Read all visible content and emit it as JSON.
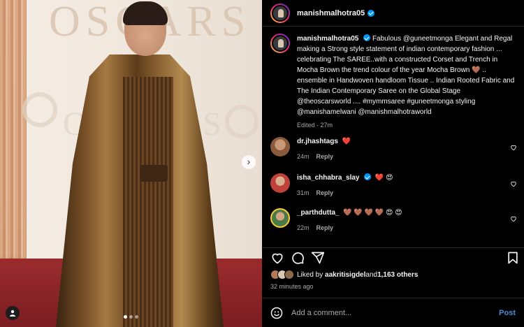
{
  "photo": {
    "backdrop_text": "OSCARS",
    "backdrop_text_small": "OSCARS",
    "carousel": {
      "total_dots": 3,
      "active_index": 0
    }
  },
  "header": {
    "username": "manishmalhotra05"
  },
  "caption": {
    "username": "manishmalhotra05",
    "text": "Fabulous @guneetmonga Elegant and Regal making a Strong style statement of indian contemporary fashion ... celebrating The SAREE..with a constructed Corset and Trench in Mocha Brown the trend colour of the year Mocha Brown 🤎 .. ensemble in Handwoven handloom Tissue .. Indian Rooted Fabric and The Indian Contemporary Saree on the Global Stage @theoscarsworld .... #mymmsaree #guneetmonga styling @manishamelwani @manishmalhotraworld",
    "meta": "Edited · 27m"
  },
  "comments": [
    {
      "username": "dr.jhashtags",
      "text": "❤️",
      "time": "24m",
      "reply": "Reply",
      "verified": false,
      "avatar_color": "#8a5a3c"
    },
    {
      "username": "isha_chhabra_slay",
      "text": "❤️ 😍",
      "time": "31m",
      "reply": "Reply",
      "verified": true,
      "avatar_color": "#c0413c"
    },
    {
      "username": "_parthdutta_",
      "text": "🤎 🤎 🤎 🤎 😍 😍",
      "time": "22m",
      "reply": "Reply",
      "verified": false,
      "avatar_color": "#4a7a4a"
    }
  ],
  "likes": {
    "prefix": "Liked by ",
    "user": "aakritisigdel",
    "joiner": " and ",
    "others": "1,163 others"
  },
  "timestamp": "32 minutes ago",
  "add_comment": {
    "placeholder": "Add a comment...",
    "post_label": "Post"
  },
  "colors": {
    "accent": "#0095f6",
    "like_red": "#ed4956",
    "post_blue": "#4a8bcf"
  },
  "icons": [
    "heart-icon",
    "comment-icon",
    "share-icon",
    "bookmark-icon",
    "emoji-icon",
    "chevron-right-icon",
    "user-tag-icon"
  ]
}
